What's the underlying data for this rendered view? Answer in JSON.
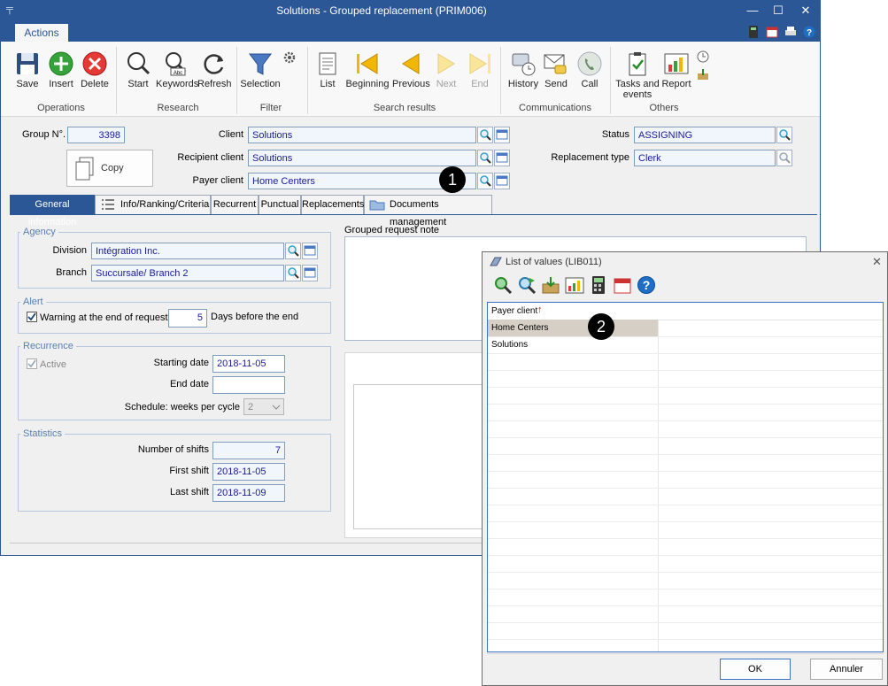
{
  "window": {
    "title": "Solutions - Grouped replacement (PRIM006)",
    "minimize": "—",
    "maximize": "☐",
    "close": "✕"
  },
  "ribbon": {
    "tab": "Actions",
    "groups": {
      "operations": "Operations",
      "research": "Research",
      "filter": "Filter",
      "search_results": "Search results",
      "communications": "Communications",
      "others": "Others"
    },
    "buttons": {
      "save": "Save",
      "insert": "Insert",
      "delete": "Delete",
      "start": "Start",
      "keywords": "Keywords",
      "refresh": "Refresh",
      "selection": "Selection",
      "list": "List",
      "beginning": "Beginning",
      "previous": "Previous",
      "next": "Next",
      "end": "End",
      "history": "History",
      "send": "Send",
      "call": "Call",
      "tasks_line1": "Tasks and",
      "tasks_line2": "events",
      "report": "Report"
    },
    "colors": {
      "titlebar": "#2b5797",
      "insert": "#36a23a",
      "delete": "#e53935",
      "nav_arrow": "#f2b705"
    }
  },
  "form": {
    "group_no": {
      "label": "Group N°.",
      "value": "3398"
    },
    "copy": "Copy",
    "client": {
      "label": "Client",
      "value": "Solutions"
    },
    "recipient": {
      "label": "Recipient client",
      "value": "Solutions"
    },
    "payer": {
      "label": "Payer client",
      "value": "Home Centers"
    },
    "status": {
      "label": "Status",
      "value": "ASSIGNING"
    },
    "replacement_type": {
      "label": "Replacement type",
      "value": "Clerk"
    }
  },
  "tabs": [
    "General information",
    "Info/Ranking/Criteria",
    "Recurrent",
    "Punctual",
    "Replacements",
    "Documents management"
  ],
  "agency": {
    "legend": "Agency",
    "division_label": "Division",
    "division": "Intégration Inc.",
    "branch_label": "Branch",
    "branch": "Succursale/ Branch 2"
  },
  "alert": {
    "legend": "Alert",
    "warning_label": "Warning at the end of request",
    "days": "5",
    "days_label": "Days before the end"
  },
  "recurrence": {
    "legend": "Recurrence",
    "active": "Active",
    "start_label": "Starting date",
    "start": "2018-11-05",
    "end_label": "End date",
    "end": "",
    "schedule_label": "Schedule: weeks per cycle",
    "schedule": "2"
  },
  "statistics": {
    "legend": "Statistics",
    "shifts_label": "Number of shifts",
    "shifts": "7",
    "first_label": "First shift",
    "first": "2018-11-05",
    "last_label": "Last shift",
    "last": "2018-11-09"
  },
  "note": {
    "label": "Grouped request note"
  },
  "dialog": {
    "title": "List of values (LIB011)",
    "column": "Payer client",
    "sort_indicator": "↑",
    "rows": [
      "Home Centers",
      "Solutions"
    ],
    "ok": "OK",
    "cancel": "Annuler"
  },
  "callouts": [
    "1",
    "2"
  ]
}
